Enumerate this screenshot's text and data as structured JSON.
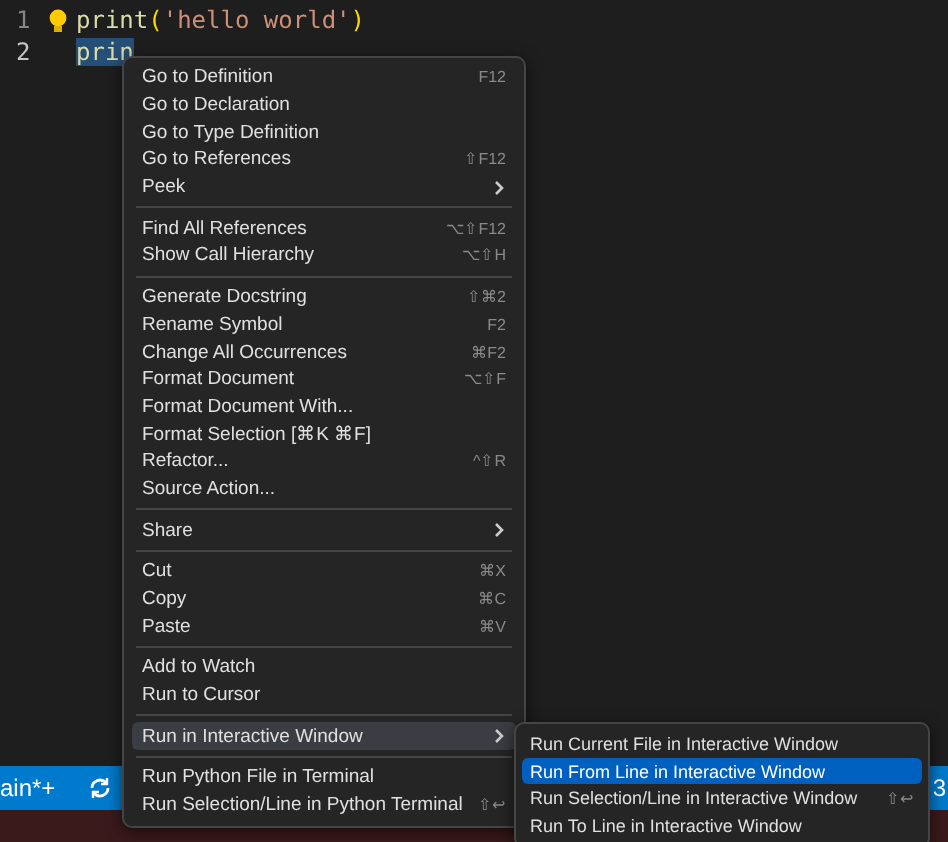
{
  "editor": {
    "lines": [
      {
        "number": "1",
        "tokens": [
          {
            "kind": "fn",
            "text": "print"
          },
          {
            "kind": "paren",
            "text": "("
          },
          {
            "kind": "str",
            "text": "'hello world'"
          },
          {
            "kind": "paren",
            "text": ")"
          }
        ],
        "selected": false,
        "bulb": true
      },
      {
        "number": "2",
        "tokens": [
          {
            "kind": "fn",
            "text": "prin"
          }
        ],
        "selected": true
      }
    ]
  },
  "context_menu": {
    "groups": [
      [
        {
          "label": "Go to Definition",
          "shortcut": "F12",
          "has_submenu": false,
          "selected": false
        },
        {
          "label": "Go to Declaration",
          "has_submenu": false,
          "selected": false
        },
        {
          "label": "Go to Type Definition",
          "has_submenu": false,
          "selected": false
        },
        {
          "label": "Go to References",
          "shortcut": "⇧F12",
          "has_submenu": false,
          "selected": false
        },
        {
          "label": "Peek",
          "has_submenu": true,
          "selected": false
        }
      ],
      [
        {
          "label": "Find All References",
          "shortcut": "⌥⇧F12",
          "has_submenu": false,
          "selected": false
        },
        {
          "label": "Show Call Hierarchy",
          "shortcut": "⌥⇧H",
          "has_submenu": false,
          "selected": false
        }
      ],
      [
        {
          "label": "Generate Docstring",
          "shortcut": "⇧⌘2",
          "has_submenu": false,
          "selected": false
        },
        {
          "label": "Rename Symbol",
          "shortcut": "F2",
          "has_submenu": false,
          "selected": false
        },
        {
          "label": "Change All Occurrences",
          "shortcut": "⌘F2",
          "has_submenu": false,
          "selected": false
        },
        {
          "label": "Format Document",
          "shortcut": "⌥⇧F",
          "has_submenu": false,
          "selected": false
        },
        {
          "label": "Format Document With...",
          "has_submenu": false,
          "selected": false
        },
        {
          "label": "Format Selection [⌘K ⌘F]",
          "has_submenu": false,
          "selected": false
        },
        {
          "label": "Refactor...",
          "shortcut": "^⇧R",
          "has_submenu": false,
          "selected": false
        },
        {
          "label": "Source Action...",
          "has_submenu": false,
          "selected": false
        }
      ],
      [
        {
          "label": "Share",
          "has_submenu": true,
          "selected": false
        }
      ],
      [
        {
          "label": "Cut",
          "shortcut": "⌘X",
          "has_submenu": false,
          "selected": false
        },
        {
          "label": "Copy",
          "shortcut": "⌘C",
          "has_submenu": false,
          "selected": false
        },
        {
          "label": "Paste",
          "shortcut": "⌘V",
          "has_submenu": false,
          "selected": false
        }
      ],
      [
        {
          "label": "Add to Watch",
          "has_submenu": false,
          "selected": false
        },
        {
          "label": "Run to Cursor",
          "has_submenu": false,
          "selected": false
        }
      ],
      [
        {
          "label": "Run in Interactive Window",
          "has_submenu": true,
          "selected": true
        }
      ],
      [
        {
          "label": "Run Python File in Terminal",
          "has_submenu": false,
          "selected": false
        },
        {
          "label": "Run Selection/Line in Python Terminal",
          "shortcut": "⇧↩",
          "has_submenu": false,
          "selected": false
        }
      ]
    ]
  },
  "submenu": {
    "items": [
      {
        "label": "Run Current File in Interactive Window",
        "selected": false
      },
      {
        "label": "Run From Line in Interactive Window",
        "selected": true
      },
      {
        "label": "Run Selection/Line in Interactive Window",
        "shortcut": "⇧↩",
        "selected": false
      },
      {
        "label": "Run To Line in Interactive Window",
        "selected": false
      }
    ]
  },
  "status_bar": {
    "branch": "ain*+",
    "right_text": "3"
  }
}
